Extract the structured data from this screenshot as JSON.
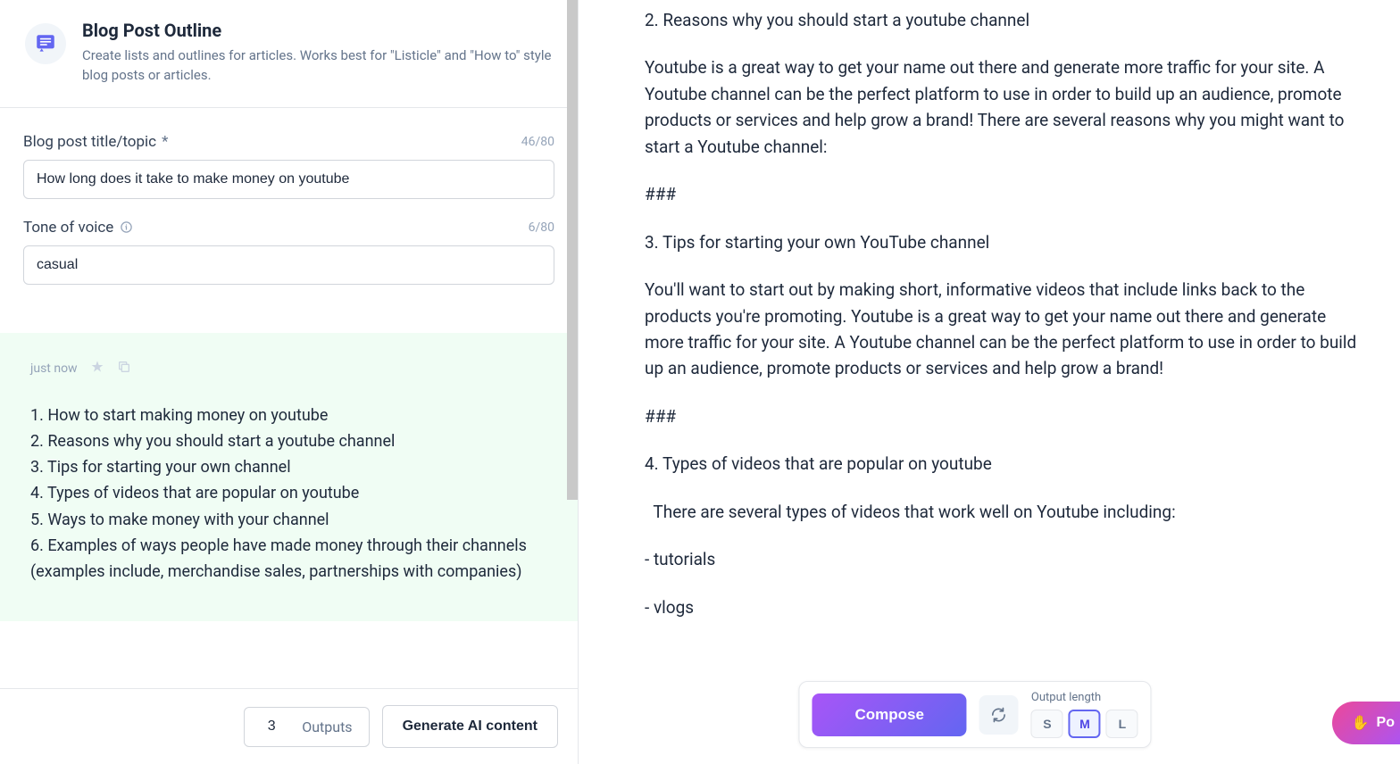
{
  "header": {
    "title": "Blog Post Outline",
    "description": "Create lists and outlines for articles. Works best for \"Listicle\" and \"How to\" style blog posts or articles."
  },
  "form": {
    "topic": {
      "label": "Blog post title/topic",
      "required_mark": "*",
      "value": "How long does it take to make money on youtube",
      "counter": "46/80"
    },
    "tone": {
      "label": "Tone of voice",
      "value": "casual",
      "counter": "6/80"
    }
  },
  "result": {
    "time": "just now",
    "items": [
      "1. How to start making money on youtube",
      "2. Reasons why you should start a youtube channel",
      "3. Tips for starting your own channel",
      "4. Types of videos that are popular on youtube",
      "5. Ways to make money with your channel",
      "6. Examples of ways people have made money through their channels (examples include, merchandise sales, partnerships with companies)"
    ]
  },
  "bottom": {
    "outputs_value": "3",
    "outputs_label": "Outputs",
    "generate_label": "Generate AI content"
  },
  "content": {
    "h2": "2. Reasons why you should start a youtube channel",
    "p2": "Youtube is a great way to get your name out there and generate more traffic for your site. A Youtube channel can be the perfect platform to use in order to build up an audience, promote products or services and help grow a brand! There are several reasons why you might want to start a Youtube channel:",
    "sep1": "###",
    "h3": "3. Tips for starting your own YouTube channel",
    "p3": "You'll want to start out by making short, informative videos that include links back to the products you're promoting. Youtube is a great way to get your name out there and generate more traffic for your site. A Youtube channel can be the perfect platform to use in order to build up an audience, promote products or services and help grow a brand!",
    "sep2": "###",
    "h4": "4. Types of videos that are popular on youtube",
    "p4": "  There are several types of videos that work well on Youtube including:",
    "li1": "- tutorials",
    "li2": "- vlogs"
  },
  "compose": {
    "button": "Compose",
    "output_length_label": "Output length",
    "lengths": {
      "s": "S",
      "m": "M",
      "l": "L"
    }
  },
  "power": {
    "label": "Po"
  }
}
